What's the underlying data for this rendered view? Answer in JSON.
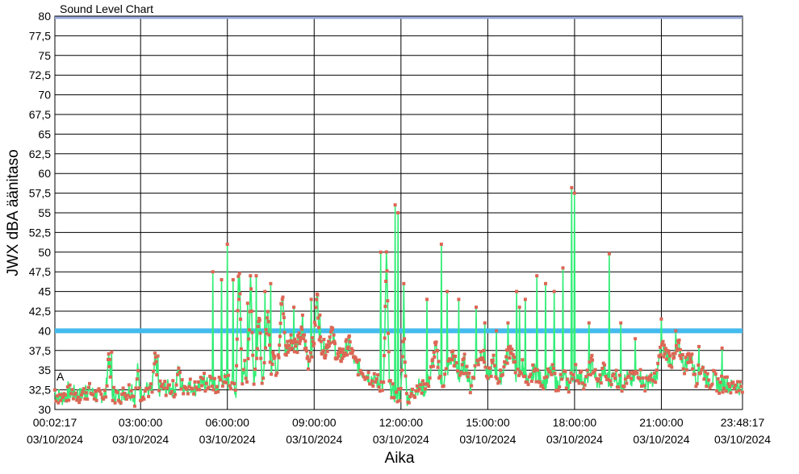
{
  "chart_data": {
    "type": "line",
    "title": "Sound Level Chart",
    "xlabel": "Aika",
    "ylabel": "JWX dBA äänitaso",
    "ylim": [
      30,
      80
    ],
    "y_ticks": [
      "30",
      "32,5",
      "35",
      "37,5",
      "40",
      "42,5",
      "45",
      "47,5",
      "50",
      "52,5",
      "55",
      "57,5",
      "60",
      "62,5",
      "65",
      "67,5",
      "70",
      "72,5",
      "75",
      "77,5",
      "80"
    ],
    "x_range_hours": [
      0.0381,
      23.8047
    ],
    "x_ticks": [
      {
        "hour": 0.0381,
        "time": "00:02:17",
        "date": "03/10/2024"
      },
      {
        "hour": 3,
        "time": "03:00:00",
        "date": "03/10/2024"
      },
      {
        "hour": 6,
        "time": "06:00:00",
        "date": "03/10/2024"
      },
      {
        "hour": 9,
        "time": "09:00:00",
        "date": "03/10/2024"
      },
      {
        "hour": 12,
        "time": "12:00:00",
        "date": "03/10/2024"
      },
      {
        "hour": 15,
        "time": "15:00:00",
        "date": "03/10/2024"
      },
      {
        "hour": 18,
        "time": "18:00:00",
        "date": "03/10/2024"
      },
      {
        "hour": 21,
        "time": "21:00:00",
        "date": "03/10/2024"
      },
      {
        "hour": 23.8047,
        "time": "23:48:17",
        "date": "03/10/2024"
      }
    ],
    "grid": true,
    "legend": "none",
    "colors": {
      "line": "#33ee77",
      "marker": "#dd6655",
      "limit": "#44bbee",
      "top_limit": "#99aadd"
    },
    "limit_lines": [
      {
        "y": 40
      },
      {
        "y": 79.8
      }
    ],
    "annotation": "A",
    "series": [
      {
        "values": [
          [
            0.04,
            32
          ],
          [
            0.3,
            31.5
          ],
          [
            0.6,
            32.2
          ],
          [
            0.9,
            31.8
          ],
          [
            1.2,
            32.4
          ],
          [
            1.5,
            31.6
          ],
          [
            1.8,
            32.1
          ],
          [
            1.9,
            37.3
          ],
          [
            2.0,
            32
          ],
          [
            2.3,
            31.7
          ],
          [
            2.6,
            32.5
          ],
          [
            2.8,
            31.5
          ],
          [
            2.9,
            35
          ],
          [
            3.0,
            32
          ],
          [
            3.2,
            32.6
          ],
          [
            3.4,
            32.3
          ],
          [
            3.5,
            36.8
          ],
          [
            3.6,
            32.5
          ],
          [
            3.9,
            32.8
          ],
          [
            4.2,
            32.6
          ],
          [
            4.3,
            35.5
          ],
          [
            4.4,
            32.9
          ],
          [
            4.7,
            33
          ],
          [
            4.9,
            32.7
          ],
          [
            5.1,
            33.3
          ],
          [
            5.3,
            33.1
          ],
          [
            5.5,
            33.5
          ],
          [
            5.6,
            32.5
          ],
          [
            5.8,
            34
          ],
          [
            6.0,
            33.4
          ],
          [
            6.2,
            33.8
          ],
          [
            6.3,
            32.2
          ],
          [
            6.4,
            51
          ],
          [
            6.5,
            34
          ],
          [
            6.6,
            36
          ],
          [
            6.7,
            33
          ],
          [
            6.8,
            46.5
          ],
          [
            6.9,
            34
          ],
          [
            7.0,
            35.5
          ],
          [
            7.1,
            42.5
          ],
          [
            7.2,
            34
          ],
          [
            7.3,
            36.5
          ],
          [
            7.4,
            43.5
          ],
          [
            7.5,
            35
          ],
          [
            7.6,
            37
          ],
          [
            7.7,
            34
          ],
          [
            7.8,
            38
          ],
          [
            7.9,
            46
          ],
          [
            8.0,
            37.5
          ],
          [
            8.2,
            39
          ],
          [
            8.4,
            38
          ],
          [
            8.6,
            40
          ],
          [
            8.8,
            36
          ],
          [
            9.0,
            39
          ],
          [
            9.1,
            45
          ],
          [
            9.2,
            38.5
          ],
          [
            9.4,
            37.5
          ],
          [
            9.6,
            40
          ],
          [
            9.8,
            36.5
          ],
          [
            10.0,
            37
          ],
          [
            10.2,
            38.5
          ],
          [
            10.4,
            36
          ],
          [
            10.6,
            35
          ],
          [
            10.8,
            34.5
          ],
          [
            11.0,
            34
          ],
          [
            11.2,
            33.5
          ],
          [
            11.4,
            33
          ],
          [
            11.5,
            49.8
          ],
          [
            11.6,
            32.8
          ],
          [
            11.8,
            31.8
          ],
          [
            12.0,
            32
          ],
          [
            12.1,
            40
          ],
          [
            12.2,
            31.5
          ],
          [
            12.4,
            32
          ],
          [
            12.6,
            33
          ],
          [
            12.8,
            32.5
          ],
          [
            13.0,
            34
          ],
          [
            13.2,
            38
          ],
          [
            13.4,
            33
          ],
          [
            13.6,
            35
          ],
          [
            13.8,
            37
          ],
          [
            14.0,
            34
          ],
          [
            14.2,
            36
          ],
          [
            14.4,
            33
          ],
          [
            14.6,
            35.5
          ],
          [
            14.8,
            37.5
          ],
          [
            15.0,
            34
          ],
          [
            15.2,
            36
          ],
          [
            15.4,
            33.5
          ],
          [
            15.6,
            36
          ],
          [
            15.8,
            38
          ],
          [
            16.0,
            34
          ],
          [
            16.2,
            35.5
          ],
          [
            16.4,
            33
          ],
          [
            16.6,
            35
          ],
          [
            16.8,
            34
          ],
          [
            17.0,
            33.5
          ],
          [
            17.2,
            35
          ],
          [
            17.4,
            33
          ],
          [
            17.6,
            34.5
          ],
          [
            17.8,
            33
          ],
          [
            18.0,
            35
          ],
          [
            18.2,
            34
          ],
          [
            18.4,
            33.5
          ],
          [
            18.6,
            36
          ],
          [
            18.8,
            33
          ],
          [
            19.0,
            35
          ],
          [
            19.2,
            33.5
          ],
          [
            19.4,
            34.5
          ],
          [
            19.6,
            33
          ],
          [
            19.8,
            34
          ],
          [
            20.0,
            33.5
          ],
          [
            20.2,
            35
          ],
          [
            20.4,
            33
          ],
          [
            20.6,
            34
          ],
          [
            20.8,
            33.5
          ],
          [
            21.0,
            38
          ],
          [
            21.2,
            37
          ],
          [
            21.4,
            36
          ],
          [
            21.6,
            38
          ],
          [
            21.8,
            35.5
          ],
          [
            22.0,
            37
          ],
          [
            22.2,
            34
          ],
          [
            22.4,
            35.5
          ],
          [
            22.6,
            33.5
          ],
          [
            22.8,
            34
          ],
          [
            23.0,
            33
          ],
          [
            23.2,
            33.5
          ],
          [
            23.4,
            32.8
          ],
          [
            23.6,
            33.2
          ],
          [
            23.8,
            32.5
          ]
        ],
        "spikes": [
          [
            0.5,
            33.6
          ],
          [
            1.1,
            33.1
          ],
          [
            2.0,
            37.3
          ],
          [
            2.7,
            33.2
          ],
          [
            3.6,
            36.8
          ],
          [
            4.3,
            35.4
          ],
          [
            5.2,
            34.6
          ],
          [
            5.5,
            47.5
          ],
          [
            5.8,
            46.5
          ],
          [
            6.0,
            51
          ],
          [
            6.2,
            46.5
          ],
          [
            6.4,
            44
          ],
          [
            6.7,
            43.5
          ],
          [
            7.0,
            47
          ],
          [
            7.3,
            45
          ],
          [
            7.5,
            46
          ],
          [
            7.9,
            44
          ],
          [
            8.3,
            43
          ],
          [
            8.6,
            42
          ],
          [
            8.9,
            44
          ],
          [
            9.2,
            42
          ],
          [
            11.3,
            50
          ],
          [
            11.8,
            56
          ],
          [
            11.9,
            55
          ],
          [
            12.1,
            46
          ],
          [
            12.9,
            44
          ],
          [
            13.4,
            51
          ],
          [
            13.6,
            45
          ],
          [
            14.0,
            44
          ],
          [
            14.6,
            43
          ],
          [
            14.9,
            41
          ],
          [
            15.3,
            40
          ],
          [
            15.7,
            41
          ],
          [
            16.0,
            45
          ],
          [
            16.1,
            43
          ],
          [
            16.3,
            44
          ],
          [
            16.7,
            47
          ],
          [
            17.0,
            46
          ],
          [
            17.3,
            45
          ],
          [
            17.6,
            48
          ],
          [
            17.9,
            58.2
          ],
          [
            18.0,
            57.5
          ],
          [
            18.5,
            41
          ],
          [
            19.2,
            49.8
          ],
          [
            19.6,
            41
          ],
          [
            20.1,
            39
          ],
          [
            21.0,
            41.5
          ],
          [
            21.5,
            40
          ],
          [
            22.3,
            38
          ],
          [
            23.1,
            37.8
          ]
        ]
      }
    ]
  }
}
